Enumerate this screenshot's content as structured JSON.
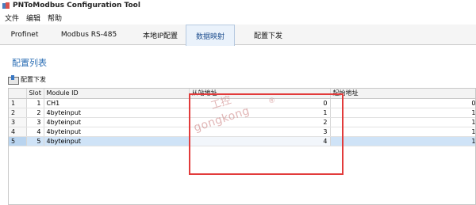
{
  "window": {
    "title": "PNToModbus Configuration Tool"
  },
  "menu": {
    "items": [
      "文件",
      "编辑",
      "帮助"
    ]
  },
  "tabs": [
    "Profinet",
    "Modbus RS-485",
    "本地IP配置",
    "数据映射",
    "配置下发"
  ],
  "active_tab": "数据映射",
  "section": {
    "title": "配置列表"
  },
  "toolbar": {
    "download_label": "配置下发"
  },
  "table": {
    "headers": [
      "",
      "Slot",
      "Module ID",
      "从站地址",
      "起始地址"
    ],
    "rows": [
      {
        "num": "1",
        "slot": "1",
        "module": "CH1",
        "slave": "0",
        "start": "0"
      },
      {
        "num": "2",
        "slot": "2",
        "module": "4byteinput",
        "slave": "1",
        "start": "1"
      },
      {
        "num": "3",
        "slot": "3",
        "module": "4byteinput",
        "slave": "2",
        "start": "1"
      },
      {
        "num": "4",
        "slot": "4",
        "module": "4byteinput",
        "slave": "3",
        "start": "1"
      },
      {
        "num": "5",
        "slot": "5",
        "module": "4byteinput",
        "slave": "4",
        "start": "1"
      }
    ],
    "selected_row": 5
  },
  "watermark": {
    "text_cn": "工控",
    "text_en": "gongkong",
    "mark": "®"
  },
  "colors": {
    "accent": "#2d6fb5",
    "highlight_box": "#e23b3b",
    "selection": "#cfe3f7"
  }
}
